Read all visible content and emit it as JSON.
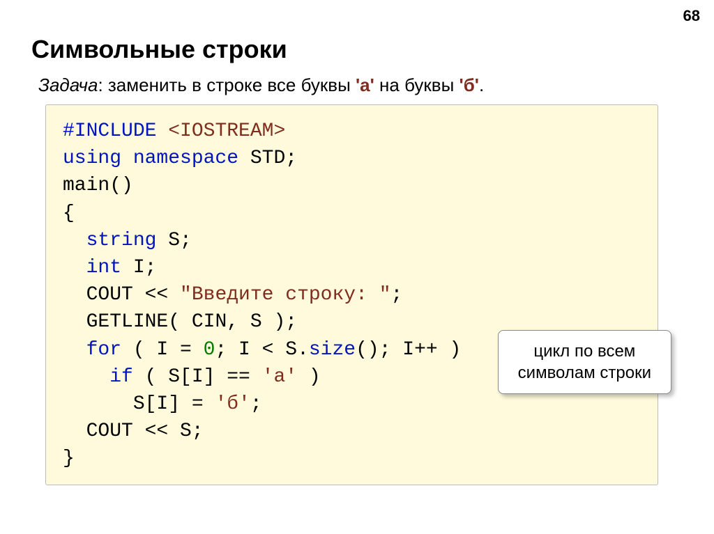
{
  "pageNumber": "68",
  "title": "Символьные строки",
  "task": {
    "label": "Задача",
    "prefix": ": заменить в строке все буквы ",
    "char1": "'а'",
    "middle": " на буквы ",
    "char2": "'б'",
    "suffix": "."
  },
  "code": {
    "l1a": "#INCLUDE ",
    "l1b": "<IOSTREAM>",
    "l2a": "using namespace ",
    "l2b": "STD",
    "l2c": ";",
    "l3": "main()",
    "l4": "{",
    "l5a": "  string ",
    "l5b": "S;",
    "l6a": "  int ",
    "l6b": "I;",
    "l7a": "  COUT ",
    "l7b": "<< ",
    "l7c": "\"Введите строку: \"",
    "l7d": ";",
    "l8a": "  GETLINE",
    "l8b": "( CIN, S );",
    "l9a": "  for",
    "l9b": " ( I = ",
    "l9c": "0",
    "l9d": "; I < S.",
    "l9e": "size",
    "l9f": "(); I++ )",
    "l10a": "    if",
    "l10b": " ( S[I] == ",
    "l10c": "'а'",
    "l10d": " )",
    "l11a": "      S[I] = ",
    "l11b": "'б'",
    "l11c": ";",
    "l12a": "  COUT ",
    "l12b": "<< S;",
    "l13": "}"
  },
  "callout": {
    "line1": "цикл по всем",
    "line2": "символам строки"
  }
}
